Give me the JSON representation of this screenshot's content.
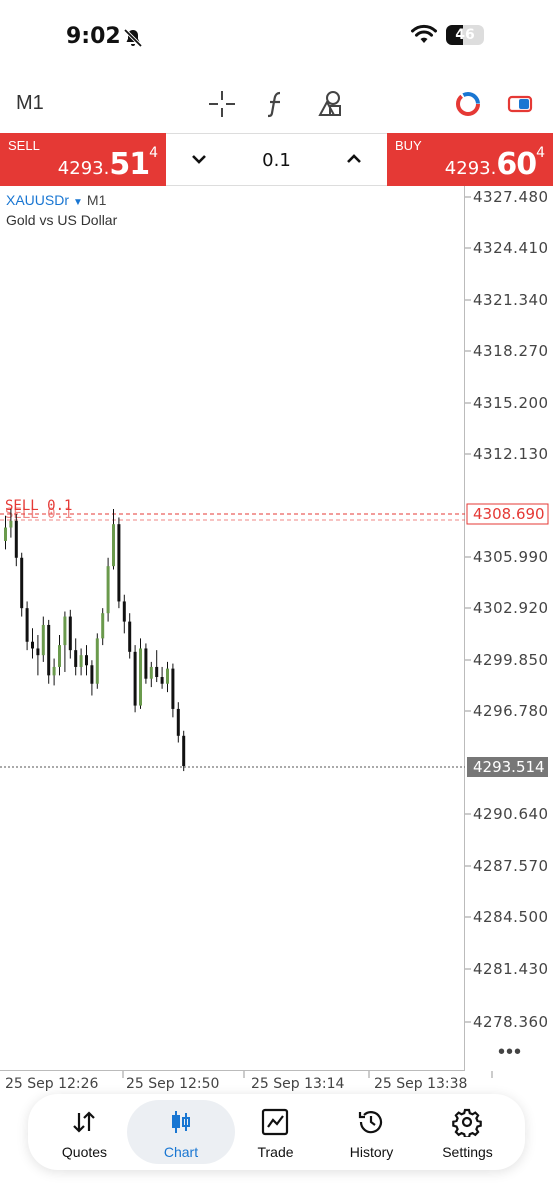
{
  "status_bar": {
    "time": "9:02",
    "battery": "46",
    "battery_level": 0.46
  },
  "toolbar": {
    "timeframe": "M1"
  },
  "trade": {
    "sell_label": "SELL",
    "sell_price_small": "4293.",
    "sell_price_big": "51",
    "sell_price_sup": "4",
    "lot": "0.1",
    "buy_label": "BUY",
    "buy_price_small": "4293.",
    "buy_price_big": "60",
    "buy_price_sup": "4"
  },
  "chart": {
    "symbol": "XAUUSDr",
    "timeframe": "M1",
    "description": "Gold vs US Dollar",
    "more": "•••"
  },
  "chart_data": {
    "type": "candlestick",
    "symbol": "XAUUSDr",
    "timeframe": "M1",
    "ylim": [
      4276.0,
      4329.0
    ],
    "y_ticks": [
      "4327.480",
      "4324.410",
      "4321.340",
      "4318.270",
      "4315.200",
      "4312.130",
      "4308.690",
      "4305.990",
      "4302.920",
      "4299.850",
      "4296.780",
      "4293.514",
      "4290.640",
      "4287.570",
      "4284.500",
      "4281.430",
      "4278.360"
    ],
    "x_ticks": [
      "25 Sep 12:26",
      "25 Sep 12:50",
      "25 Sep 13:14",
      "25 Sep 13:38"
    ],
    "current_price": 4293.514,
    "current_price_label": "4293.514",
    "order_line": {
      "label": "SELL 0.1",
      "price": 4308.69,
      "price_label": "4308.690"
    },
    "order_line_2": {
      "label": "SELL 0.1",
      "price": 4308.25
    },
    "colors": {
      "bull": "#6a9a4c",
      "bear": "#111111",
      "order": "#e53935",
      "price_tag": "#777777"
    },
    "candles": [
      [
        4307.0,
        4308.5,
        4306.5,
        4307.8
      ],
      [
        4307.8,
        4308.9,
        4307.2,
        4308.2
      ],
      [
        4308.2,
        4308.6,
        4305.5,
        4306.0
      ],
      [
        4306.0,
        4306.3,
        4302.5,
        4303.0
      ],
      [
        4303.0,
        4303.4,
        4300.5,
        4301.0
      ],
      [
        4301.0,
        4301.8,
        4300.0,
        4300.6
      ],
      [
        4300.6,
        4301.4,
        4299.0,
        4300.2
      ],
      [
        4300.2,
        4302.5,
        4299.8,
        4302.0
      ],
      [
        4302.0,
        4302.3,
        4298.5,
        4299.0
      ],
      [
        4299.0,
        4300.0,
        4298.4,
        4299.5
      ],
      [
        4299.5,
        4301.4,
        4299.0,
        4300.8
      ],
      [
        4300.8,
        4302.8,
        4299.2,
        4302.5
      ],
      [
        4302.5,
        4302.9,
        4300.0,
        4300.5
      ],
      [
        4300.5,
        4301.2,
        4299.0,
        4299.5
      ],
      [
        4299.5,
        4300.6,
        4299.0,
        4300.2
      ],
      [
        4300.2,
        4300.8,
        4299.0,
        4299.6
      ],
      [
        4299.6,
        4299.9,
        4297.8,
        4298.5
      ],
      [
        4298.5,
        4301.5,
        4298.2,
        4301.2
      ],
      [
        4301.2,
        4303.0,
        4300.8,
        4302.7
      ],
      [
        4302.7,
        4306.0,
        4302.2,
        4305.5
      ],
      [
        4305.5,
        4308.9,
        4305.3,
        4308.0
      ],
      [
        4308.0,
        4308.4,
        4303.0,
        4303.4
      ],
      [
        4303.4,
        4303.8,
        4301.5,
        4302.2
      ],
      [
        4302.2,
        4302.7,
        4300.0,
        4300.4
      ],
      [
        4300.4,
        4300.8,
        4296.8,
        4297.2
      ],
      [
        4297.2,
        4301.2,
        4297.0,
        4300.6
      ],
      [
        4300.6,
        4300.9,
        4298.5,
        4298.8
      ],
      [
        4298.8,
        4299.8,
        4298.3,
        4299.5
      ],
      [
        4299.5,
        4300.5,
        4298.6,
        4298.9
      ],
      [
        4298.9,
        4299.5,
        4298.2,
        4298.5
      ],
      [
        4298.5,
        4299.8,
        4298.0,
        4299.4
      ],
      [
        4299.4,
        4299.7,
        4296.5,
        4297.0
      ],
      [
        4297.0,
        4297.4,
        4295.0,
        4295.4
      ],
      [
        4295.4,
        4295.7,
        4293.3,
        4293.6
      ]
    ]
  },
  "nav": {
    "items": [
      {
        "label": "Quotes"
      },
      {
        "label": "Chart"
      },
      {
        "label": "Trade"
      },
      {
        "label": "History"
      },
      {
        "label": "Settings"
      }
    ]
  }
}
